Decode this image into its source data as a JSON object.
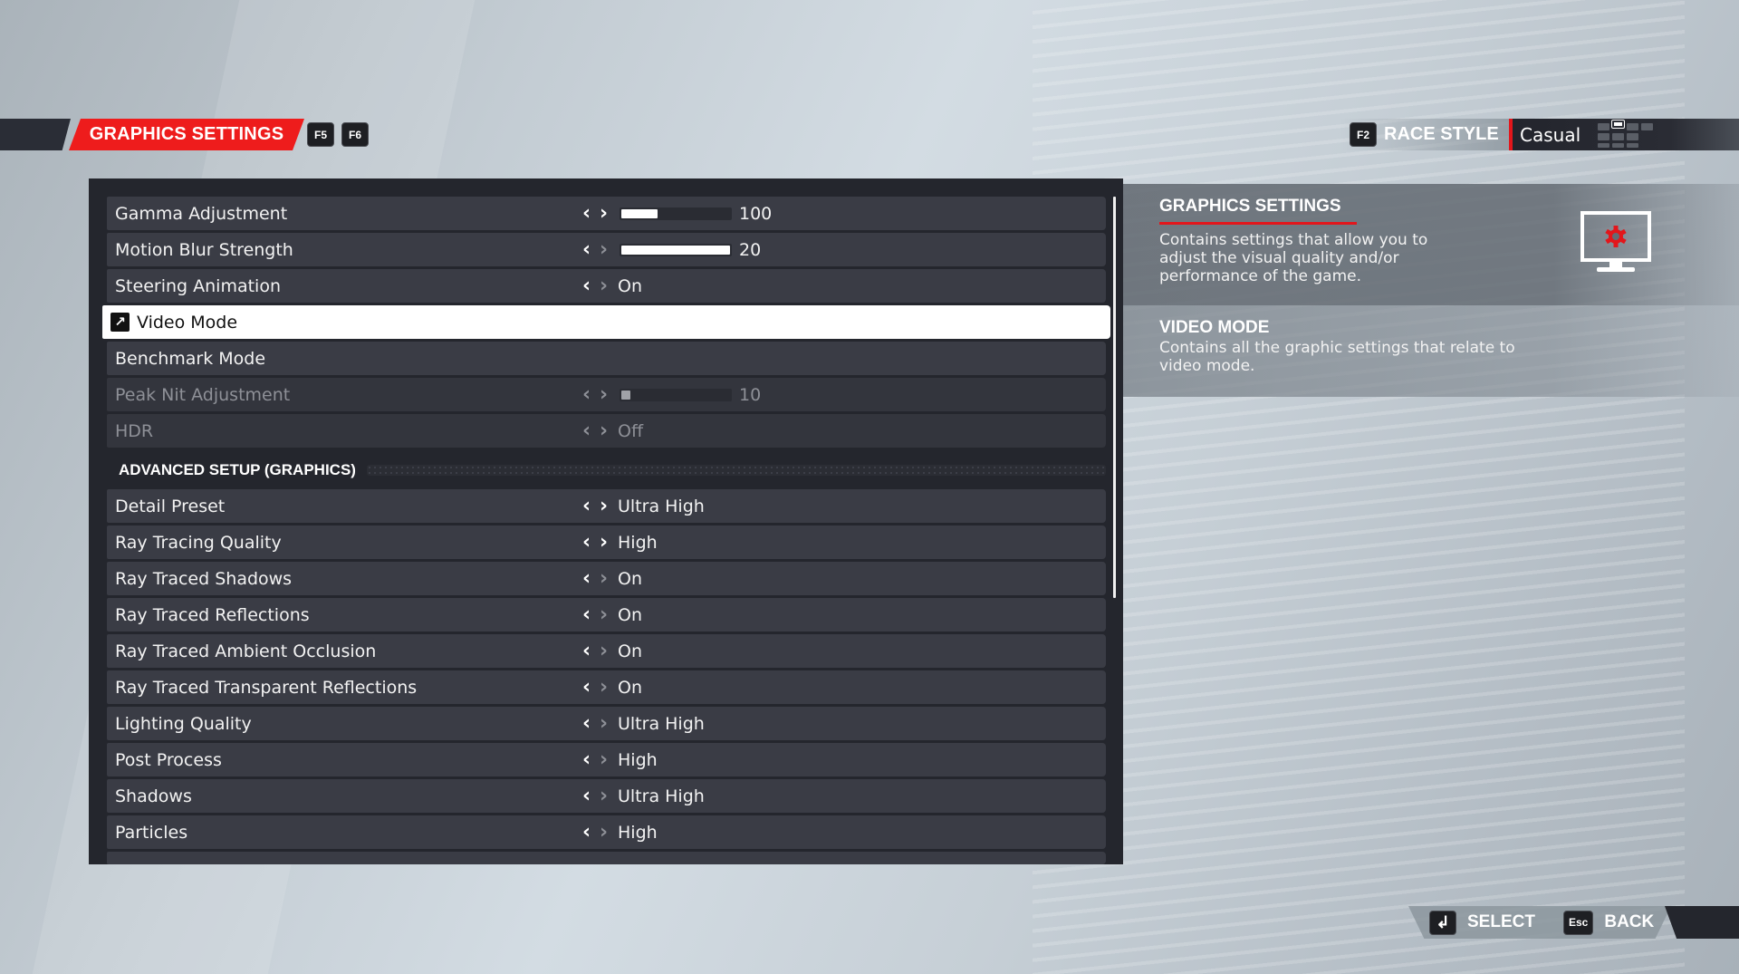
{
  "header": {
    "title": "GRAPHICS SETTINGS",
    "prev_key": "F5",
    "next_key": "F6",
    "race_style_key": "F2",
    "race_style_label": "RACE STYLE",
    "race_style_value": "Casual",
    "accent_color": "#ee1c1c"
  },
  "settings": [
    {
      "label": "Gamma Adjustment",
      "type": "slider",
      "value": "100",
      "fill": 0.33,
      "left_enabled": true,
      "right_enabled": true
    },
    {
      "label": "Motion Blur Strength",
      "type": "slider",
      "value": "20",
      "fill": 1.0,
      "left_enabled": true,
      "right_enabled": false
    },
    {
      "label": "Steering Animation",
      "type": "option",
      "value": "On",
      "left_enabled": true,
      "right_enabled": false
    },
    {
      "label": "Video Mode",
      "type": "link",
      "selected": true
    },
    {
      "label": "Benchmark Mode",
      "type": "link"
    },
    {
      "label": "Peak Nit Adjustment",
      "type": "slider",
      "value": "10",
      "fill": 0.08,
      "disabled": true
    },
    {
      "label": "HDR",
      "type": "option",
      "value": "Off",
      "disabled": true
    }
  ],
  "advanced_section": {
    "title": "ADVANCED SETUP (GRAPHICS)",
    "items": [
      {
        "label": "Detail Preset",
        "value": "Ultra High",
        "right_enabled": true
      },
      {
        "label": "Ray Tracing Quality",
        "value": "High",
        "right_enabled": true
      },
      {
        "label": "Ray Traced Shadows",
        "value": "On",
        "right_enabled": false
      },
      {
        "label": "Ray Traced Reflections",
        "value": "On",
        "right_enabled": false
      },
      {
        "label": "Ray Traced Ambient Occlusion",
        "value": "On",
        "right_enabled": false
      },
      {
        "label": "Ray Traced Transparent Reflections",
        "value": "On",
        "right_enabled": false
      },
      {
        "label": "Lighting Quality",
        "value": "Ultra High",
        "right_enabled": false
      },
      {
        "label": "Post Process",
        "value": "High",
        "right_enabled": false
      },
      {
        "label": "Shadows",
        "value": "Ultra High",
        "right_enabled": false
      },
      {
        "label": "Particles",
        "value": "High",
        "right_enabled": false
      }
    ]
  },
  "icons": {
    "left_arrow": "‹",
    "right_arrow": "›",
    "link": "↗",
    "enter": "↲"
  },
  "info": {
    "section_title": "GRAPHICS SETTINGS",
    "section_description_lines": [
      "Contains settings that allow you to",
      "adjust the visual quality and/or",
      "performance of the game."
    ],
    "item_title": "VIDEO MODE",
    "item_description_lines": [
      "Contains all the graphic settings that relate to",
      "video mode."
    ]
  },
  "footer": {
    "select_label": "SELECT",
    "back_key": "Esc",
    "back_label": "BACK"
  }
}
